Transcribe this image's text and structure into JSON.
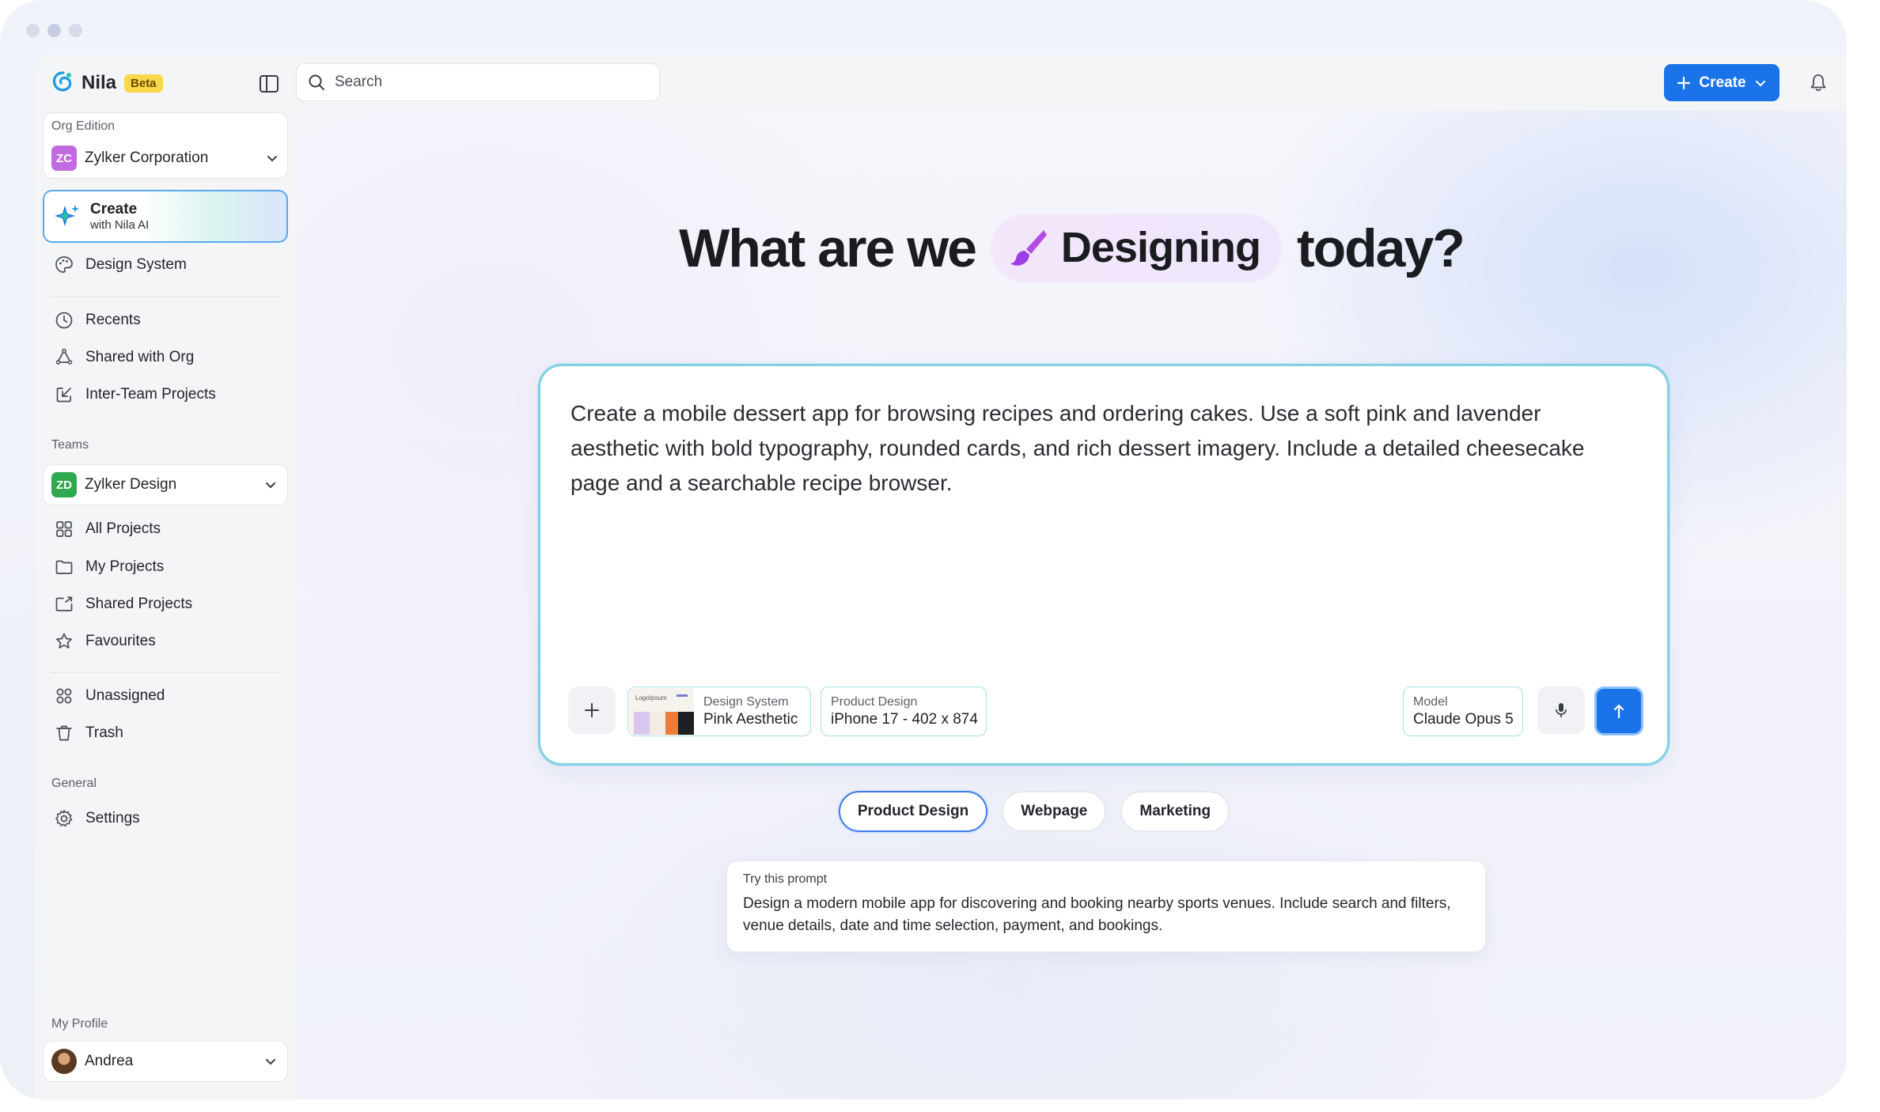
{
  "brand": {
    "name": "Nila",
    "badge": "Beta"
  },
  "search": {
    "placeholder": "Search"
  },
  "topbar": {
    "create_label": "Create"
  },
  "sidebar": {
    "org_section_label": "Org Edition",
    "org": {
      "initials": "ZC",
      "name": "Zylker Corporation",
      "color": "#b35bd9"
    },
    "create_ai": {
      "title": "Create",
      "subtitle": "with Nila AI"
    },
    "design_system": "Design System",
    "nav_primary": [
      "Recents",
      "Shared with Org",
      "Inter-Team Projects"
    ],
    "teams_label": "Teams",
    "team": {
      "initials": "ZD",
      "name": "Zylker Design",
      "color": "#2fa84f"
    },
    "nav_team": [
      "All Projects",
      "My Projects",
      "Shared Projects",
      "Favourites"
    ],
    "nav_misc": [
      "Unassigned",
      "Trash"
    ],
    "general_label": "General",
    "settings": "Settings",
    "profile_label": "My Profile",
    "profile_name": "Andrea"
  },
  "main": {
    "headline_before": "What are we",
    "headline_pill": "Designing",
    "headline_after": "today?",
    "prompt_text": "Create a mobile dessert app for browsing recipes and ordering cakes. Use a soft pink and lavender aesthetic with bold typography, rounded cards, and rich dessert imagery. Include a detailed cheesecake page and a searchable recipe browser.",
    "chips": {
      "design_system_label": "Design System",
      "design_system_value": "Pink Aesthetic",
      "design_system_thumb_text": "LogoIpsum",
      "product_label": "Product Design",
      "product_value": "iPhone 17 - 402 x 874",
      "model_label": "Model",
      "model_value": "Claude Opus 5"
    },
    "tabs": [
      "Product Design",
      "Webpage",
      "Marketing"
    ],
    "active_tab": "Product Design",
    "try_prompt_label": "Try this prompt",
    "try_prompt_text": "Design a modern mobile app for discovering and booking nearby sports venues. Include search and filters, venue details, date and time selection, payment, and bookings."
  },
  "colors": {
    "accent": "#1a73e8",
    "beta_badge": "#fbd84a",
    "prompt_border": "#7fd2e0"
  }
}
